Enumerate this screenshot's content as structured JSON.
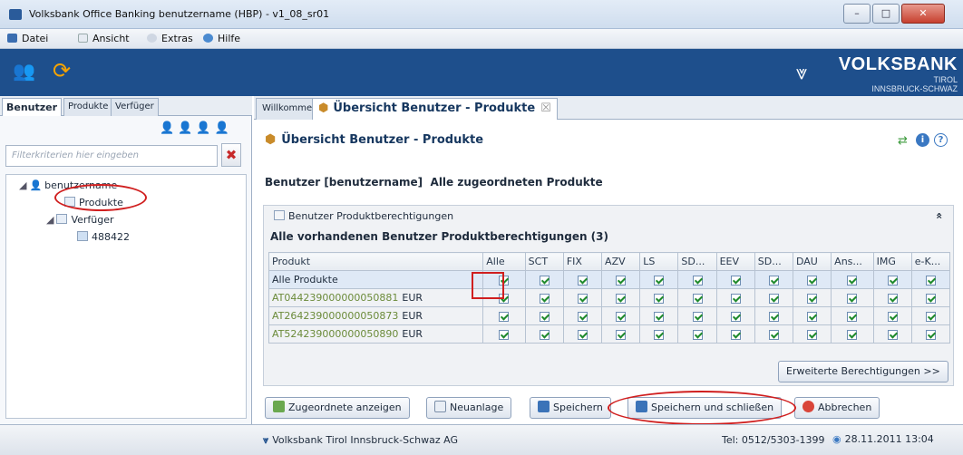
{
  "window": {
    "title": "Volksbank Office Banking benutzername (HBP) - v1_08_sr01",
    "min": "–",
    "max": "□",
    "close": "✕"
  },
  "menu": [
    {
      "label": "Datei"
    },
    {
      "label": "Ansicht"
    },
    {
      "label": "Extras"
    },
    {
      "label": "Hilfe"
    }
  ],
  "logo": {
    "name": "VOLKSBANK",
    "sub1": "TIROL",
    "sub2": "INNSBRUCK-SCHWAZ"
  },
  "left_tabs": [
    {
      "label": "Benutzer"
    },
    {
      "label": "Produkte"
    },
    {
      "label": "Verfüger"
    }
  ],
  "filter": {
    "placeholder": "Filterkriterien hier eingeben",
    "clear": "✖"
  },
  "tree": {
    "root": "benutzername",
    "child1": "Produkte",
    "child2": "Verfüger",
    "grandchild": "488422"
  },
  "right_tabs": [
    {
      "label": "Willkommen"
    },
    {
      "label": "Übersicht Benutzer - Produkte",
      "close": "☒"
    }
  ],
  "page": {
    "title": "Übersicht Benutzer - Produkte",
    "subtitle": "Benutzer [benutzername]  Alle zugeordneten Produkte",
    "section_title": "Benutzer Produktberechtigungen",
    "table_title": "Alle vorhandenen Benutzer Produktberechtigungen (3)",
    "collapse": "«"
  },
  "table": {
    "columns": [
      "Produkt",
      "Alle",
      "SCT",
      "FIX",
      "AZV",
      "LS",
      "SD...",
      "EEV",
      "SD...",
      "DAU",
      "Ans...",
      "IMG",
      "e-K..."
    ],
    "rows": [
      {
        "product": "Alle Produkte",
        "currency": ""
      },
      {
        "product": "AT044239000000050881",
        "currency": "EUR"
      },
      {
        "product": "AT264239000000050873",
        "currency": "EUR"
      },
      {
        "product": "AT524239000000050890",
        "currency": "EUR"
      }
    ]
  },
  "buttons": {
    "extended": "Erweiterte Berechtigungen >>",
    "show_assigned": "Zugeordnete anzeigen",
    "new": "Neuanlage",
    "save": "Speichern",
    "save_close": "Speichern und schließen",
    "cancel": "Abbrechen"
  },
  "status": {
    "bank": "Volksbank Tirol Innsbruck-Schwaz AG",
    "phone": "Tel: 0512/5303-1399",
    "date": "28.11.2011 13:04"
  },
  "colors": {
    "banner": "#1e4f8c",
    "annotation": "#d01f1f",
    "check": "#1f8a2c"
  }
}
